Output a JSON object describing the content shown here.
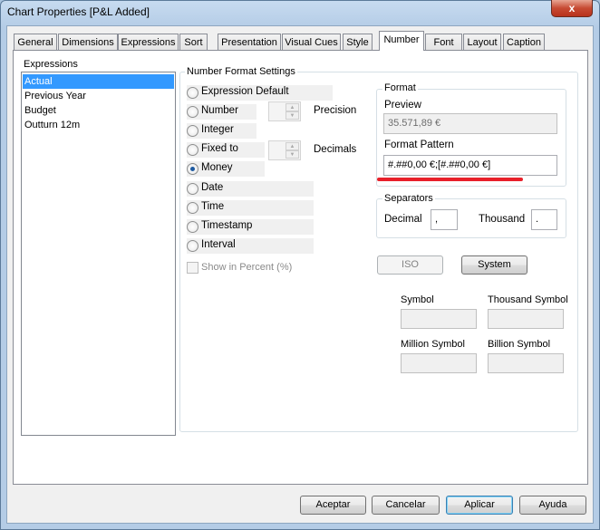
{
  "window": {
    "title": "Chart Properties [P&L Added]",
    "close_label": "x"
  },
  "tabs": [
    {
      "label": "General"
    },
    {
      "label": "Dimensions"
    },
    {
      "label": "Expressions"
    },
    {
      "label": "Sort"
    },
    {
      "label": "Presentation"
    },
    {
      "label": "Visual Cues"
    },
    {
      "label": "Style"
    },
    {
      "label": "Number",
      "active": true
    },
    {
      "label": "Font"
    },
    {
      "label": "Layout"
    },
    {
      "label": "Caption"
    }
  ],
  "expressions": {
    "label": "Expressions",
    "items": [
      "Actual",
      "Previous Year",
      "Budget",
      "Outturn 12m"
    ],
    "selected": "Actual"
  },
  "number_format": {
    "label": "Number Format Settings",
    "options": [
      "Expression Default",
      "Number",
      "Integer",
      "Fixed to",
      "Money",
      "Date",
      "Time",
      "Timestamp",
      "Interval"
    ],
    "selected": "Money",
    "precision_label": "Precision",
    "decimals_label": "Decimals",
    "show_percent_label": "Show in Percent (%)",
    "show_percent_checked": false
  },
  "format": {
    "label": "Format",
    "preview_label": "Preview",
    "preview_value": "35.571,89 €",
    "pattern_label": "Format Pattern",
    "pattern_value": "#.##0,00 €;[#.##0,00 €]",
    "highlight_color": "#e8202a"
  },
  "separators": {
    "label": "Separators",
    "decimal_label": "Decimal",
    "decimal_value": ",",
    "thousand_label": "Thousand",
    "thousand_value": "."
  },
  "buttons": {
    "iso": "ISO",
    "system": "System",
    "ok": "Aceptar",
    "cancel": "Cancelar",
    "apply": "Aplicar",
    "help": "Ayuda"
  },
  "symbols": {
    "symbol": "Symbol",
    "thousand": "Thousand Symbol",
    "million": "Million Symbol",
    "billion": "Billion Symbol"
  }
}
